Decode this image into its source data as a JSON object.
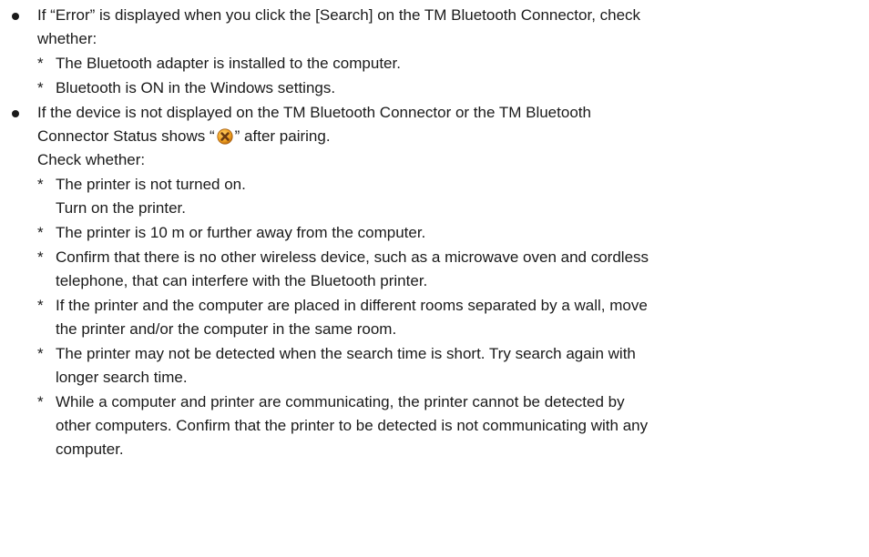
{
  "bullet1": {
    "lines": [
      "If “Error” is displayed when you click the [Search] on the TM Bluetooth Connector, check",
      "whether:"
    ],
    "items": [
      [
        "The Bluetooth adapter is installed to the computer."
      ],
      [
        "Bluetooth is ON in the Windows settings."
      ]
    ]
  },
  "bullet2": {
    "line1": "If the device is not displayed on the TM Bluetooth Connector or the TM Bluetooth",
    "line2_before": "Connector Status shows “",
    "line2_icon": "error-status-icon",
    "line2_after": "” after pairing.",
    "line3": "Check whether:",
    "items": [
      [
        "The printer is not turned on.",
        "Turn on the printer."
      ],
      [
        "The printer is 10 m or further away from the computer."
      ],
      [
        "Confirm that there is no other wireless device, such as a microwave oven and cordless",
        "telephone, that can interfere with the Bluetooth printer."
      ],
      [
        "If the printer and the computer are placed in different rooms separated by a wall, move",
        "the printer and/or the computer in the same room."
      ],
      [
        "The printer may not be detected when the search time is short. Try search again with",
        "longer search time."
      ],
      [
        "While a computer and printer are communicating, the printer cannot be detected by",
        "other computers. Confirm that the printer to be detected is not communicating with any",
        "computer."
      ]
    ]
  },
  "markers": {
    "sub_item": "*"
  },
  "colors": {
    "text": "#1a1a1a",
    "icon_fill": "#f0a020",
    "icon_cross": "#6b3a10"
  }
}
